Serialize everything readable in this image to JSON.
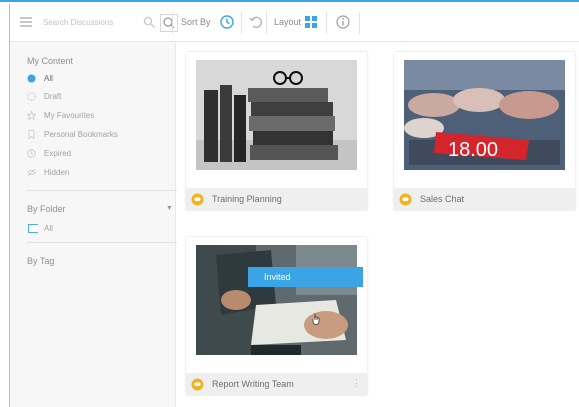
{
  "toolbar": {
    "search_placeholder": "Search Discussions",
    "sort_by_label": "Sort By",
    "layout_label": "Layout"
  },
  "sidebar": {
    "my_content_title": "My Content",
    "items": [
      {
        "label": "All",
        "icon": "circle-icon"
      },
      {
        "label": "Draft",
        "icon": "draft-icon"
      },
      {
        "label": "My Favourites",
        "icon": "star-icon"
      },
      {
        "label": "Personal Bookmarks",
        "icon": "bookmark-icon"
      },
      {
        "label": "Expired",
        "icon": "clock-icon"
      },
      {
        "label": "Hidden",
        "icon": "eye-off-icon"
      }
    ],
    "by_folder_title": "By Folder",
    "folder_items": [
      {
        "label": "All"
      }
    ],
    "by_tag_title": "By Tag"
  },
  "cards": [
    {
      "title": "Training Planning"
    },
    {
      "title": "Sales Chat"
    },
    {
      "title": "Report Writing Team",
      "badge": "Invited"
    }
  ],
  "card_images": {
    "card1_price": "18.00"
  },
  "colors": {
    "accent": "#3aa4e6",
    "chat_icon": "#f0b323"
  }
}
